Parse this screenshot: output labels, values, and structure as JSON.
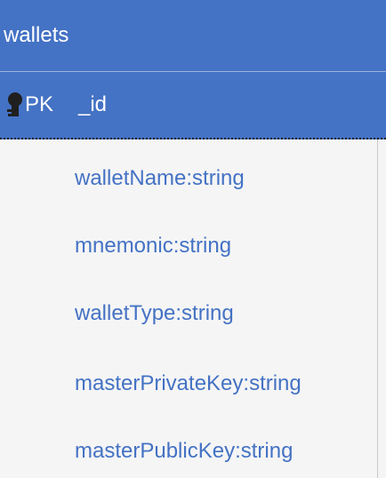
{
  "entity": {
    "name": "wallets",
    "primary_key": {
      "label": "PK",
      "name": "_id",
      "icon": "key-icon"
    },
    "fields": [
      "walletName:string",
      "mnemonic:string",
      "walletType:string",
      "masterPrivateKey:string",
      "masterPublicKey:string"
    ]
  },
  "colors": {
    "header_bg": "#4472c4",
    "field_text": "#4472c4",
    "body_bg": "#f5f5f5"
  }
}
